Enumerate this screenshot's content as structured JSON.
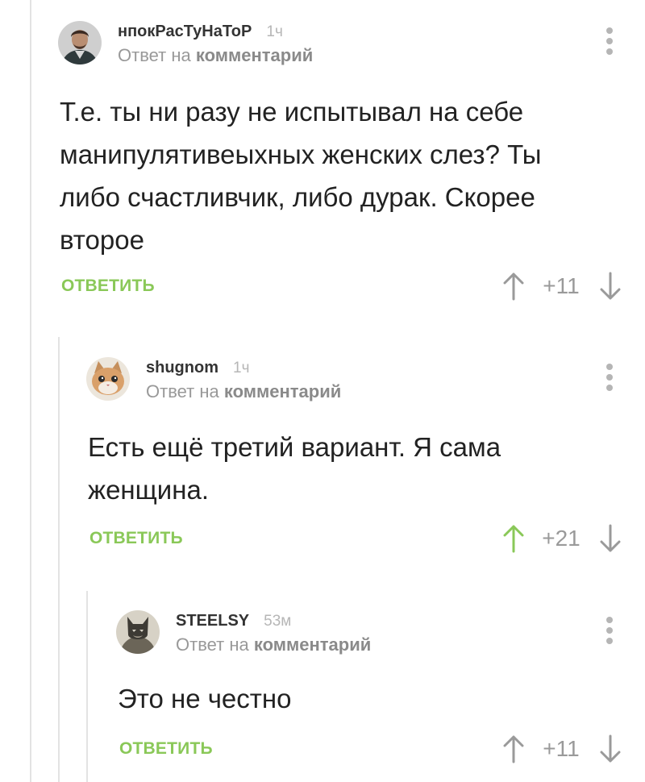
{
  "comments": [
    {
      "username": "нпокРасТуНаТоР",
      "time": "1ч",
      "reply_prefix": "Ответ на",
      "reply_link": "комментарий",
      "text": "Т.е. ты ни разу не испытывал на себе\nманипулятивеыхных женских слез? Ты\nлибо счастливчик, либо дурак. Скорее\nвторое",
      "reply_label": "ОТВЕТИТЬ",
      "score": "+11",
      "upvoted": false
    },
    {
      "username": "shugnom",
      "time": "1ч",
      "reply_prefix": "Ответ на",
      "reply_link": "комментарий",
      "text": "Есть ещё третий вариант. Я сама\nженщина.",
      "reply_label": "ОТВЕТИТЬ",
      "score": "+21",
      "upvoted": true
    },
    {
      "username": "STEELSY",
      "time": "53м",
      "reply_prefix": "Ответ на",
      "reply_link": "комментарий",
      "text": "Это не честно",
      "reply_label": "ОТВЕТИТЬ",
      "score": "+11",
      "upvoted": false
    }
  ],
  "colors": {
    "accent_green": "#8ac858",
    "vote_gray": "#9a9a9a",
    "thread_line": "#e3e3e3"
  },
  "icons": {
    "upvote": "arrow-up-icon",
    "downvote": "arrow-down-icon",
    "menu": "vertical-dots-icon"
  }
}
